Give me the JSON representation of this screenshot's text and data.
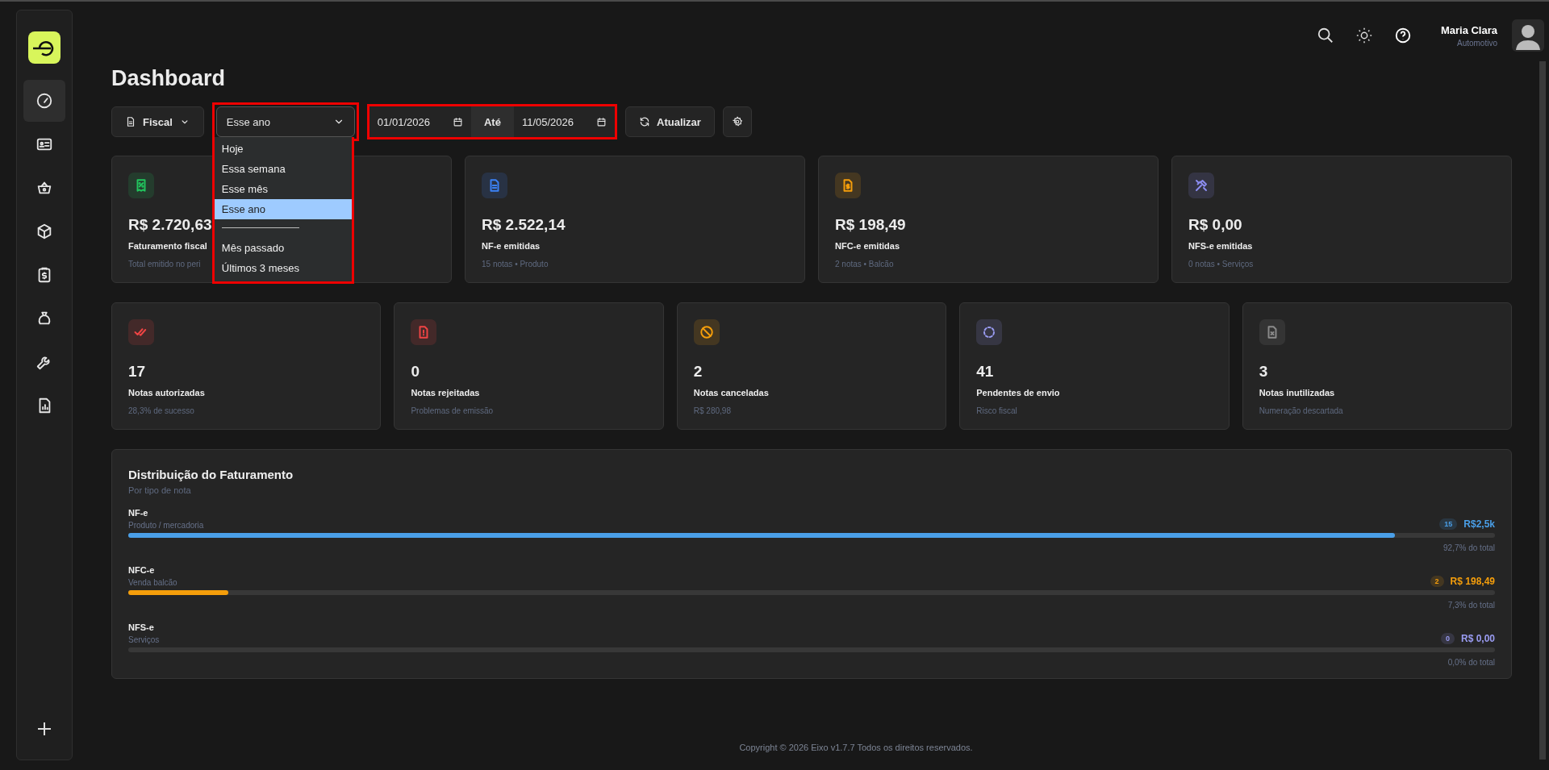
{
  "sidebar": {
    "nav_items": [
      {
        "selected": true
      },
      {
        "selected": false
      },
      {
        "selected": false
      },
      {
        "selected": false
      },
      {
        "selected": false
      },
      {
        "selected": false
      },
      {
        "selected": false
      },
      {
        "selected": false
      }
    ]
  },
  "header": {
    "user_name": "Maria Clara",
    "user_role": "Automotivo"
  },
  "title": "Dashboard",
  "toolbar": {
    "module_button": "Fiscal",
    "period_select": {
      "value": "Esse ano",
      "expanded": true,
      "highlighted": true,
      "options": [
        {
          "label": "Hoje",
          "selected": false
        },
        {
          "label": "Essa semana",
          "selected": false
        },
        {
          "label": "Esse mês",
          "selected": false
        },
        {
          "label": "Esse ano",
          "selected": true
        },
        {
          "kind": "divider"
        },
        {
          "label": "Mês passado",
          "selected": false
        },
        {
          "label": "Últimos 3 meses",
          "selected": false
        }
      ]
    },
    "date_range": {
      "highlighted": true,
      "start": "01/01/2026",
      "separator": "Até",
      "end": "11/05/2026"
    },
    "refresh_button": "Atualizar"
  },
  "summary_cards": [
    {
      "value": "R$ 2.720,63",
      "label": "Faturamento fiscal",
      "note": "Total emitido no peri",
      "color": "#22c55e"
    },
    {
      "value": "R$ 2.522,14",
      "label": "NF-e emitidas",
      "note": "15 notas • Produto",
      "color": "#3b82f6"
    },
    {
      "value": "R$ 198,49",
      "label": "NFC-e emitidas",
      "note": "2 notas • Balcão",
      "color": "#f59e0b"
    },
    {
      "value": "R$ 0,00",
      "label": "NFS-e emitidas",
      "note": "0 notas • Serviços",
      "color": "#8b8cf0"
    }
  ],
  "status_cards": [
    {
      "value": "17",
      "label": "Notas autorizadas",
      "note": "28,3% de sucesso",
      "color": "#ef4444"
    },
    {
      "value": "0",
      "label": "Notas rejeitadas",
      "note": "Problemas de emissão",
      "color": "#ef4444"
    },
    {
      "value": "2",
      "label": "Notas canceladas",
      "note": "R$ 280,98",
      "color": "#f59e0b"
    },
    {
      "value": "41",
      "label": "Pendentes de envio",
      "note": "Risco fiscal",
      "color": "#9a9cf2"
    },
    {
      "value": "3",
      "label": "Notas inutilizadas",
      "note": "Numeração descartada",
      "color": "#8a8a8a"
    }
  ],
  "distribution": {
    "title": "Distribuição do Faturamento",
    "subtitle": "Por tipo de nota",
    "rows": [
      {
        "name": "NF-e",
        "description": "Produto / mercadoria",
        "count": "15",
        "amount": "R$2,5k",
        "level": 0.927,
        "share": "92,7% do total",
        "color": "#4a9fe8"
      },
      {
        "name": "NFC-e",
        "description": "Venda balcão",
        "count": "2",
        "amount": "R$ 198,49",
        "level": 0.073,
        "share": "7,3% do total",
        "color": "#f59e0b"
      },
      {
        "name": "NFS-e",
        "description": "Serviços",
        "count": "0",
        "amount": "R$ 0,00",
        "level": 0,
        "share": "0,0% do total",
        "color": "#9a9cf2"
      }
    ]
  },
  "footer": "Copyright © 2026 Eixo v1.7.7 Todos os direitos reservados."
}
